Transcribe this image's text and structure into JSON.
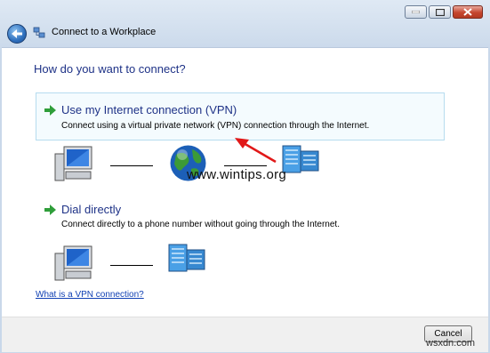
{
  "window": {
    "title": "Connect to a Workplace"
  },
  "heading": "How do you want to connect?",
  "options": [
    {
      "label": "Use my Internet connection (VPN)",
      "description": "Connect using a virtual private network (VPN) connection through the Internet."
    },
    {
      "label": "Dial directly",
      "description": "Connect directly to a phone number without going through the Internet."
    }
  ],
  "help_link": "What is a VPN connection?",
  "cancel_label": "Cancel",
  "watermark": "www.wintips.org",
  "site_watermark": "wsxdn.com",
  "icons": [
    "back-arrow-icon",
    "network-icon",
    "computer-icon",
    "globe-icon",
    "server-icon",
    "green-arrow-icon",
    "red-pointer-arrow-icon"
  ]
}
